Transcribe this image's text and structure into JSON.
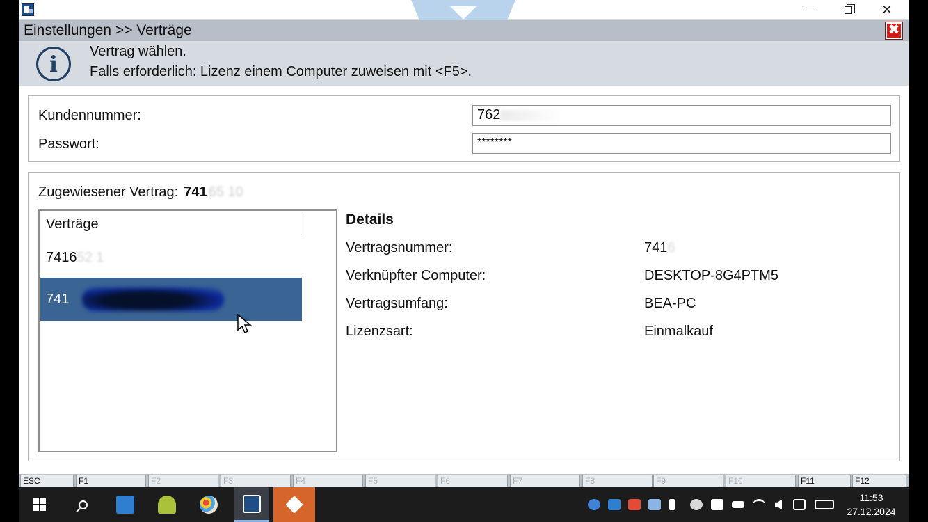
{
  "window": {
    "minimize_symbol": "",
    "close_symbol": "✕"
  },
  "header": {
    "title": "Einstellungen >> Verträge",
    "close_symbol": "✖"
  },
  "info": {
    "icon_glyph": "i",
    "line1": "Vertrag wählen.",
    "line2": "Falls erforderlich: Lizenz einem Computer zuweisen mit <F5>."
  },
  "credentials": {
    "kundennummer_label": "Kundennummer:",
    "kundennummer_value": "762",
    "passwort_label": "Passwort:",
    "passwort_value": "********"
  },
  "contracts": {
    "assigned_label": "Zugewiesener Vertrag:",
    "assigned_value": "741",
    "assigned_blurred": "65   10",
    "list_header": "Verträge",
    "items": [
      {
        "visible": "7416",
        "blurred": "52   1"
      },
      {
        "visible": "741",
        "blurred": ""
      }
    ]
  },
  "details": {
    "title": "Details",
    "rows": [
      {
        "label": "Vertragsnummer:",
        "value": "741",
        "blurred": "6"
      },
      {
        "label": "Verknüpfter Computer:",
        "value": "DESKTOP-8G4PTM5"
      },
      {
        "label": "Vertragsumfang:",
        "value": "BEA-PC"
      },
      {
        "label": "Lizenzsart:",
        "value": "Einmalkauf"
      }
    ]
  },
  "fkeys": [
    "ESC",
    "F1",
    "F2",
    "F3",
    "F4",
    "F5",
    "F6",
    "F7",
    "F8",
    "F9",
    "F10",
    "F11",
    "F12"
  ],
  "taskbar": {
    "time": "11:53",
    "date": "27.12.2024"
  },
  "colors": {
    "selection": "#3a6494",
    "header_bg": "#b7bec7",
    "info_bg": "#d6dbe1",
    "close_red": "#d21b1b",
    "taskbar": "#1c1c1c"
  }
}
